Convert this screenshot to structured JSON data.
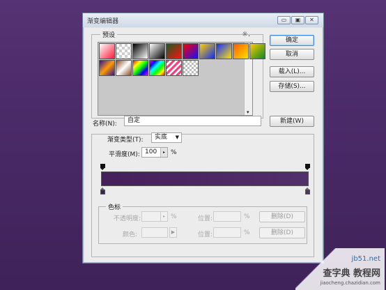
{
  "window": {
    "title": "渐变编辑器",
    "min_glyph": "▭",
    "max_glyph": "▣",
    "close_glyph": "✕"
  },
  "presets": {
    "legend": "预设",
    "menu_glyph": "☼.",
    "swatches": [
      "linear-gradient(135deg,#ffffff,#ff1a3a)",
      "repeating-conic-gradient(#cfcfcf 0 25%,#ffffff 0 50%) 0 0/8px 8px",
      "linear-gradient(135deg,#000,#fff)",
      "linear-gradient(135deg,#fff,#000)",
      "linear-gradient(135deg,#1e5a1e,#ff1010)",
      "linear-gradient(135deg,#ff0000,#1010ff)",
      "linear-gradient(135deg,#ffd200,#0a2bff)",
      "linear-gradient(135deg,#1530ff,#ffe000)",
      "linear-gradient(135deg,#ff5a00,#ffe400)",
      "linear-gradient(135deg,#ffcc00,#0a8a2a)",
      "linear-gradient(135deg,#3010a0,#ff9a00,#3010a0)",
      "linear-gradient(135deg,#8a4a20,#ffffff,#8a4a20)",
      "linear-gradient(135deg,#ff0000,#ffff00,#00ff00,#0000ff,#ff00ff)",
      "linear-gradient(135deg,#ff00ff,#0000ff,#00ffff,#00ff00,#ffff00,#ff0000)",
      "repeating-linear-gradient(135deg,#ff3b7a 0 3px,#ffffff 3px 6px)",
      "repeating-conic-gradient(#bdbdbd 0 25%,#ffffff 0 50%) 0 0/6px 6px"
    ]
  },
  "buttons": {
    "ok": "确定",
    "cancel": "取消",
    "load": "载入(L)...",
    "save": "存储(S)...",
    "new": "新建(W)"
  },
  "name": {
    "label": "名称(N):",
    "value": "自定"
  },
  "gradient": {
    "type_label": "渐变类型(T):",
    "type_value": "实底",
    "smooth_label": "平滑度(M):",
    "smooth_value": "100",
    "smooth_unit": "%",
    "bar_colors": [
      "#451f5a",
      "#52306c"
    ]
  },
  "color_stops": {
    "legend": "色标",
    "opacity_label": "不透明度:",
    "opacity_unit": "%",
    "location_label_1": "位置:",
    "location_unit_1": "%",
    "delete_1": "删除(D)",
    "color_label": "颜色:",
    "location_label_2": "位置:",
    "location_unit_2": "%",
    "delete_2": "删除(D)"
  },
  "watermark": {
    "text_1": "jb51.net",
    "text_2": "查字典 教程网",
    "text_3": "jiaocheng.chazidian.com"
  }
}
